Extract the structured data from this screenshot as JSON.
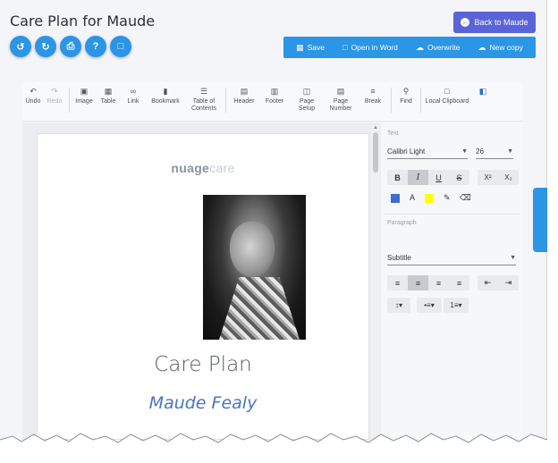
{
  "header": {
    "title": "Care Plan for Maude",
    "back_label": "Back to Maude"
  },
  "actions": {
    "save": "Save",
    "open_word": "Open in Word",
    "overwrite": "Overwrite",
    "new_copy": "New copy"
  },
  "toolbar": {
    "undo": "Undo",
    "redo": "Redo",
    "image": "Image",
    "table": "Table",
    "link": "Link",
    "bookmark": "Bookmark",
    "toc": "Table of Contents",
    "header": "Header",
    "footer": "Footer",
    "page_setup": "Page Setup",
    "page_number": "Page Number",
    "break": "Break",
    "find": "Find",
    "local_clipboard": "Local Clipboard"
  },
  "document": {
    "logo_nu": "nuage",
    "logo_care": "care",
    "title": "Care Plan",
    "subtitle": "Maude Fealy"
  },
  "props": {
    "text_label": "Text",
    "font": "Calibri Light",
    "size": "26",
    "paragraph_label": "Paragraph",
    "style": "Subtitle",
    "font_color": "#3b6fd1",
    "highlight_color": "#ffff00"
  }
}
